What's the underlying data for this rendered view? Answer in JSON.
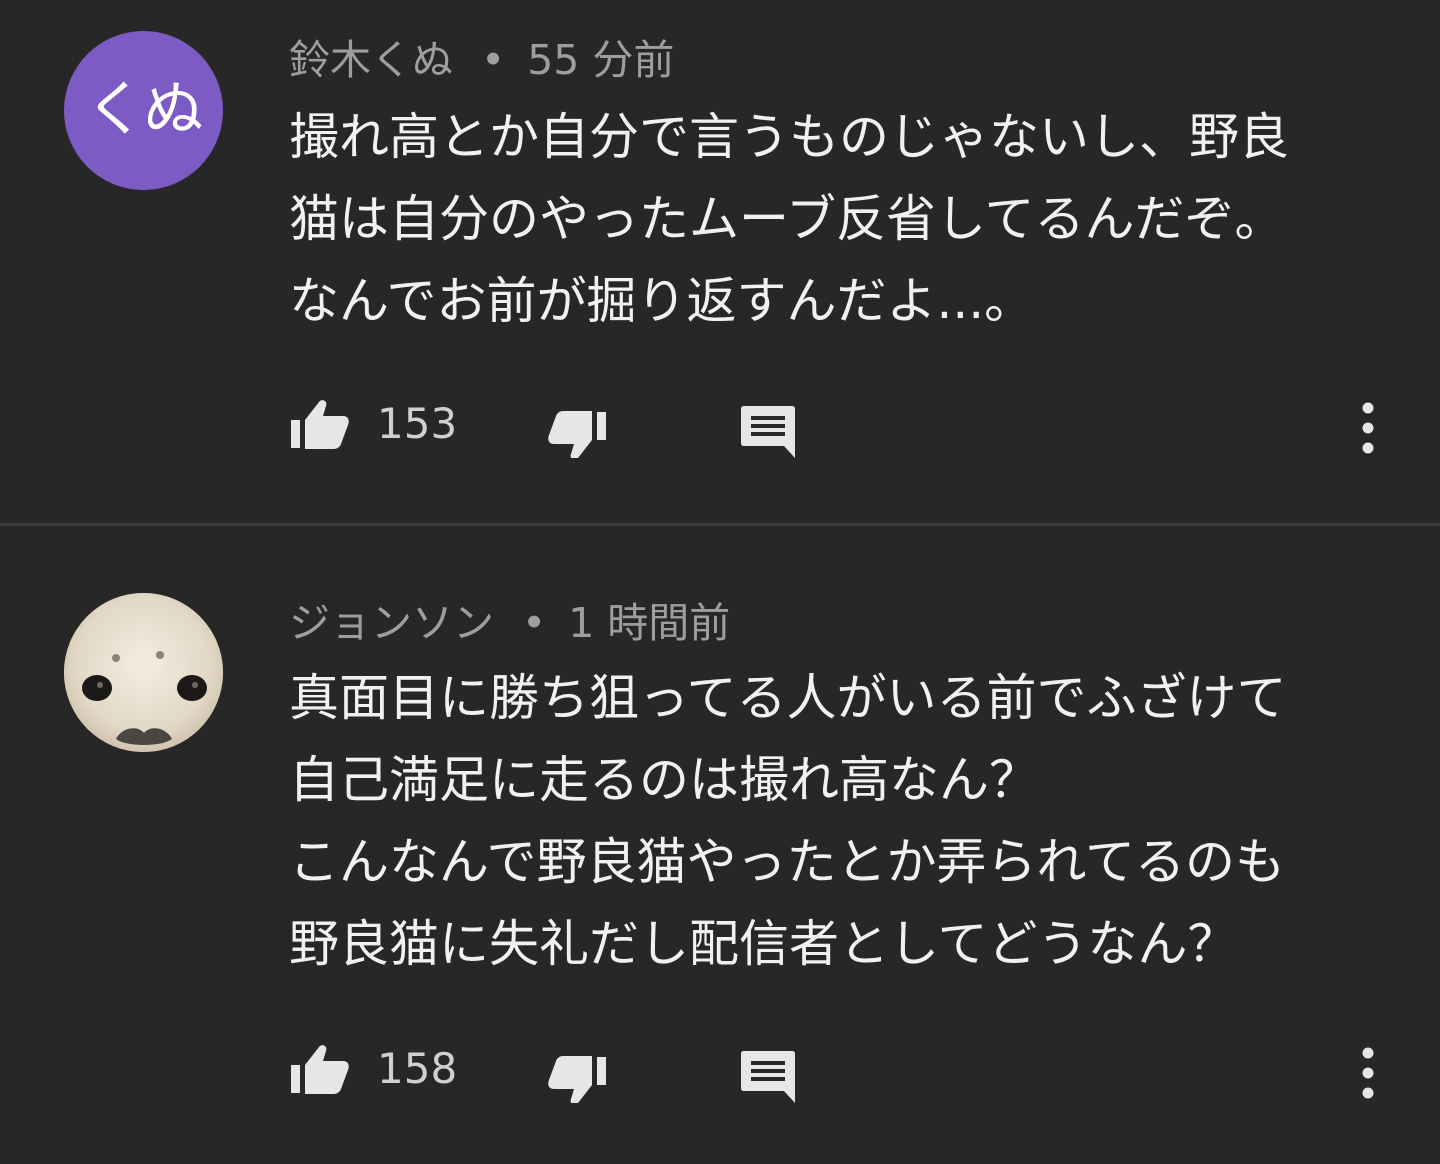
{
  "comments": [
    {
      "author": "鈴木くぬ",
      "separator": "•",
      "time": "55 分前",
      "avatar_text": "くぬ",
      "avatar_color": "#7c5cc4",
      "body_lines": [
        "撮れ高とか自分で言うものじゃないし、野良",
        "猫は自分のやったムーブ反省してるんだぞ。",
        "なんでお前が掘り返すんだよ...。"
      ],
      "likes": "153"
    },
    {
      "author": "ジョンソン",
      "separator": "•",
      "time": "1 時間前",
      "avatar_image": "seal-face",
      "body_lines": [
        "真面目に勝ち狙ってる人がいる前でふざけて",
        "自己満足に走るのは撮れ高なん？",
        "こんなんで野良猫やったとか弄られてるのも",
        "野良猫に失礼だし配信者としてどうなん？"
      ],
      "likes": "158"
    }
  ],
  "icons": {
    "like": "thumbs-up-icon",
    "dislike": "thumbs-down-icon",
    "reply": "comment-reply-icon",
    "more": "more-vertical-icon"
  },
  "colors": {
    "background": "#272727",
    "text": "#f1f1f1",
    "meta": "#9e9e9e",
    "icon": "#e6e6e6",
    "divider": "#3e3e3e"
  }
}
